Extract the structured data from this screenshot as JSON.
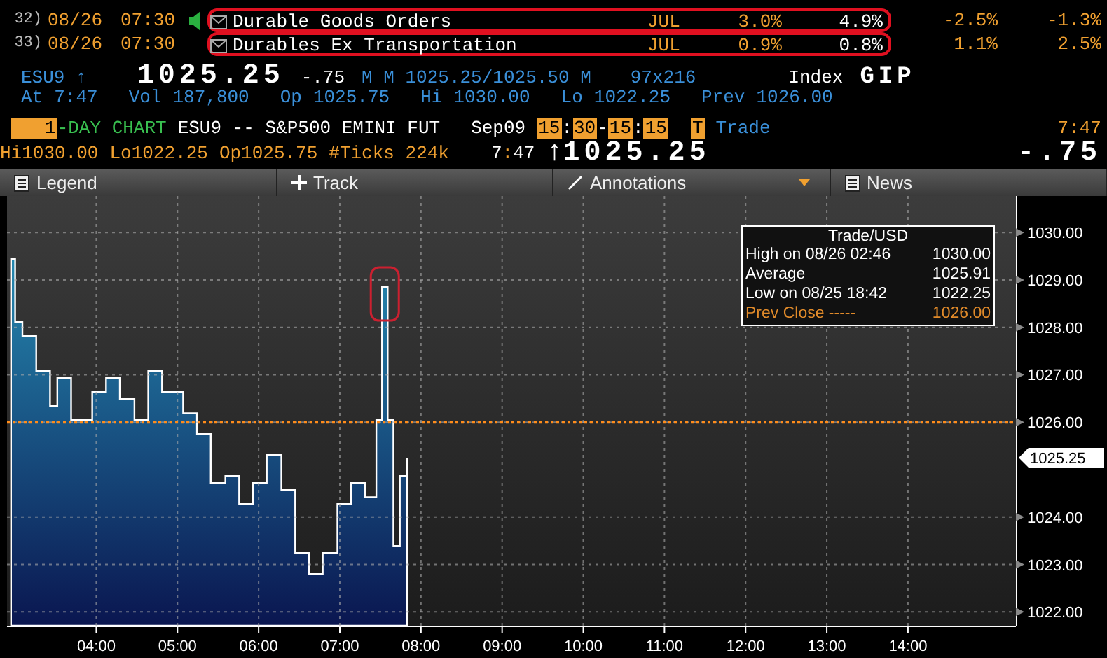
{
  "events": [
    {
      "number": "32)",
      "date": "08/26",
      "time": "07:30",
      "alert": true,
      "highlighted": true,
      "event": "Durable Goods Orders",
      "period": "JUL",
      "survey": "3.0%",
      "actual": "4.9%",
      "prior": "-2.5%",
      "revised": "-1.3%"
    },
    {
      "number": "33)",
      "date": "08/26",
      "time": "07:30",
      "alert": false,
      "highlighted": true,
      "event": "Durables Ex Transportation",
      "period": "JUL",
      "survey": "0.9%",
      "actual": "0.8%",
      "prior": "1.1%",
      "revised": "2.5%"
    }
  ],
  "quote": {
    "ticker": "ESU9 ↑",
    "last": "1025.25",
    "change": "-.75",
    "bid_ask": "M M 1025.25/1025.50 M",
    "size": "97x216",
    "sector": "Index",
    "function": "GIP",
    "stats": [
      {
        "label": "At",
        "value": "7:47"
      },
      {
        "label": "Vol",
        "value": "187,800"
      },
      {
        "label": "Op",
        "value": "1025.75"
      },
      {
        "label": "Hi",
        "value": "1030.00"
      },
      {
        "label": "Lo",
        "value": "1022.25"
      },
      {
        "label": "Prev",
        "value": "1026.00"
      }
    ]
  },
  "chart_header": {
    "days": "1",
    "chart_type": "-DAY CHART",
    "security": "ESU9 -- S&P500 EMINI FUT",
    "contract": "Sep09",
    "session": [
      "15",
      ":",
      "30",
      "-",
      "15",
      ":",
      "15"
    ],
    "mode_key": "T",
    "mode": "Trade",
    "time": "7:47",
    "summary": [
      "Hi1030.00",
      "Lo1022.25",
      "Op1025.75",
      "#Ticks 224k"
    ],
    "last_time": {
      "hour": "7",
      "sep": ":",
      "minute": "47"
    },
    "arrow": "↑",
    "last": "1025.25",
    "change": "-.75"
  },
  "toolbar": [
    {
      "kind": "legend",
      "label": "Legend"
    },
    {
      "kind": "track",
      "label": "Track"
    },
    {
      "kind": "annotations",
      "label": "Annotations"
    },
    {
      "kind": "news",
      "label": "News"
    }
  ],
  "chart": {
    "legend": {
      "title": "Trade/USD",
      "rows": [
        {
          "kind": "normal",
          "label": "High on  08/26 02:46",
          "value": "1030.00"
        },
        {
          "kind": "normal",
          "label": "Average",
          "value": "1025.91"
        },
        {
          "kind": "normal",
          "label": "Low on  08/25 18:42",
          "value": "1022.25"
        },
        {
          "kind": "prev",
          "label": "Prev Close -----",
          "value": "1026.00"
        }
      ]
    },
    "last_price": "1025.25",
    "chart_data": {
      "type": "area",
      "x": [
        2.95,
        3.0,
        3.09,
        3.26,
        3.43,
        3.52,
        3.69,
        3.95,
        4.12,
        4.29,
        4.47,
        4.64,
        4.81,
        5.07,
        5.24,
        5.41,
        5.59,
        5.76,
        5.93,
        6.1,
        6.28,
        6.45,
        6.62,
        6.79,
        6.97,
        7.14,
        7.31,
        7.45,
        7.52,
        7.59,
        7.66,
        7.74,
        7.83
      ],
      "series": [
        {
          "color": "#ffffff",
          "values": [
            1029.44,
            1028.11,
            1027.82,
            1027.08,
            1026.34,
            1026.93,
            1026.05,
            1026.64,
            1026.93,
            1026.49,
            1026.05,
            1027.08,
            1026.64,
            1026.19,
            1025.75,
            1024.72,
            1024.87,
            1024.28,
            1024.72,
            1025.31,
            1024.57,
            1023.24,
            1022.8,
            1023.24,
            1024.28,
            1024.72,
            1024.42,
            1026.05,
            1028.85,
            1026.05,
            1023.39,
            1024.87,
            1025.25
          ]
        }
      ],
      "xlim": [
        2.9,
        15.33
      ],
      "ylim": [
        1021.71,
        1030.77
      ],
      "xticks": [
        {
          "value": 4,
          "label": "04:00"
        },
        {
          "value": 5,
          "label": "05:00"
        },
        {
          "value": 6,
          "label": "06:00"
        },
        {
          "value": 7,
          "label": "07:00"
        },
        {
          "value": 8,
          "label": "08:00"
        },
        {
          "value": 9,
          "label": "09:00"
        },
        {
          "value": 10,
          "label": "10:00"
        },
        {
          "value": 11,
          "label": "11:00"
        },
        {
          "value": 12,
          "label": "12:00"
        },
        {
          "value": 13,
          "label": "13:00"
        },
        {
          "value": 14,
          "label": "14:00"
        }
      ],
      "yticks": [
        {
          "value": 1022,
          "label": "1022.00"
        },
        {
          "value": 1023,
          "label": "1023.00"
        },
        {
          "value": 1024,
          "label": "1024.00"
        },
        {
          "value": 1026,
          "label": "1026.00"
        },
        {
          "value": 1027,
          "label": "1027.00"
        },
        {
          "value": 1028,
          "label": "1028.00"
        },
        {
          "value": 1029,
          "label": "1029.00"
        },
        {
          "value": 1030,
          "label": "1030.00"
        }
      ],
      "grid": true,
      "ref_lines": [
        {
          "axis": "y",
          "value": 1026,
          "color": "#ff8c1a"
        }
      ]
    }
  }
}
